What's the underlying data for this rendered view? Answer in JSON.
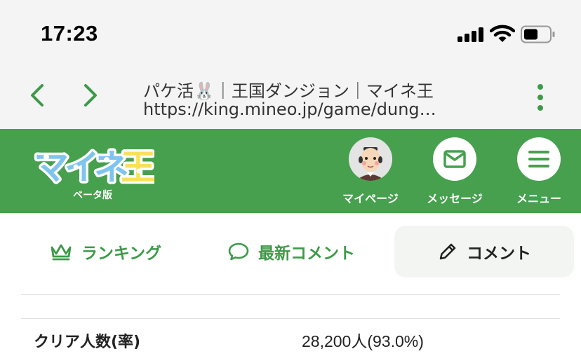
{
  "status_bar": {
    "time": "17:23"
  },
  "browser": {
    "title": "パケ活🐰｜王国ダンジョン｜マイネ王",
    "url": "https://king.mineo.jp/game/dung…"
  },
  "header": {
    "logo_text": "マイネ王",
    "beta_label": "ベータ版",
    "items": [
      {
        "label": "マイページ"
      },
      {
        "label": "メッセージ"
      },
      {
        "label": "メニュー"
      }
    ]
  },
  "tabs": [
    {
      "label": "ランキング",
      "icon": "crown-icon"
    },
    {
      "label": "最新コメント",
      "icon": "speech-bubble-icon"
    },
    {
      "label": "コメント",
      "icon": "pencil-icon"
    }
  ],
  "stats": {
    "clear_label": "クリア人数(率)",
    "clear_value": "28,200人(93.0%)"
  },
  "colors": {
    "brand_green": "#46a04e",
    "nav_green": "#3d9a48"
  }
}
